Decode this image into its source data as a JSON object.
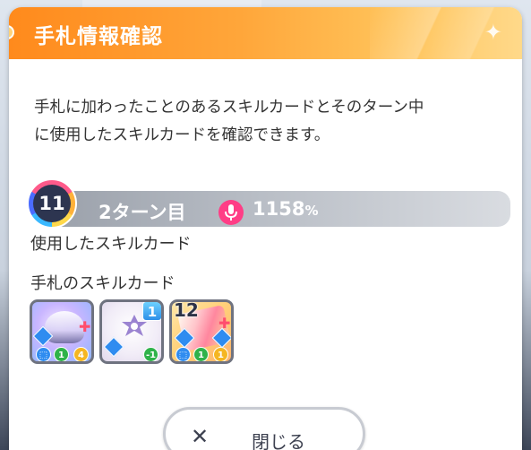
{
  "dialog": {
    "title": "手札情報確認",
    "description_line1": "手札に加わったことのあるスキルカードとそのターン中",
    "description_line2": "に使用したスキルカードを確認できます。"
  },
  "turn": {
    "number": "11",
    "label": "2ターン目",
    "score": "1158",
    "score_unit": "%",
    "icon": "microphone-icon"
  },
  "sections": {
    "used_label": "使用したスキルカード",
    "hand_label": "手札のスキルカード"
  },
  "cards": [
    {
      "icon": "skill-card-idol-group",
      "cost": "",
      "chips": [
        "1",
        "4"
      ]
    },
    {
      "icon": "skill-card-emblem",
      "cost": "1",
      "chips": [
        "-1"
      ]
    },
    {
      "icon": "skill-card-ribbon",
      "cost": "",
      "count": "12",
      "chips": [
        "1",
        "1"
      ]
    }
  ],
  "close_button": {
    "label": "閉じる"
  },
  "colors": {
    "header_start": "#ff8a1c",
    "header_end": "#ffd98a",
    "score_icon": "#ff3d86",
    "badge_bg": "#2d3550"
  }
}
